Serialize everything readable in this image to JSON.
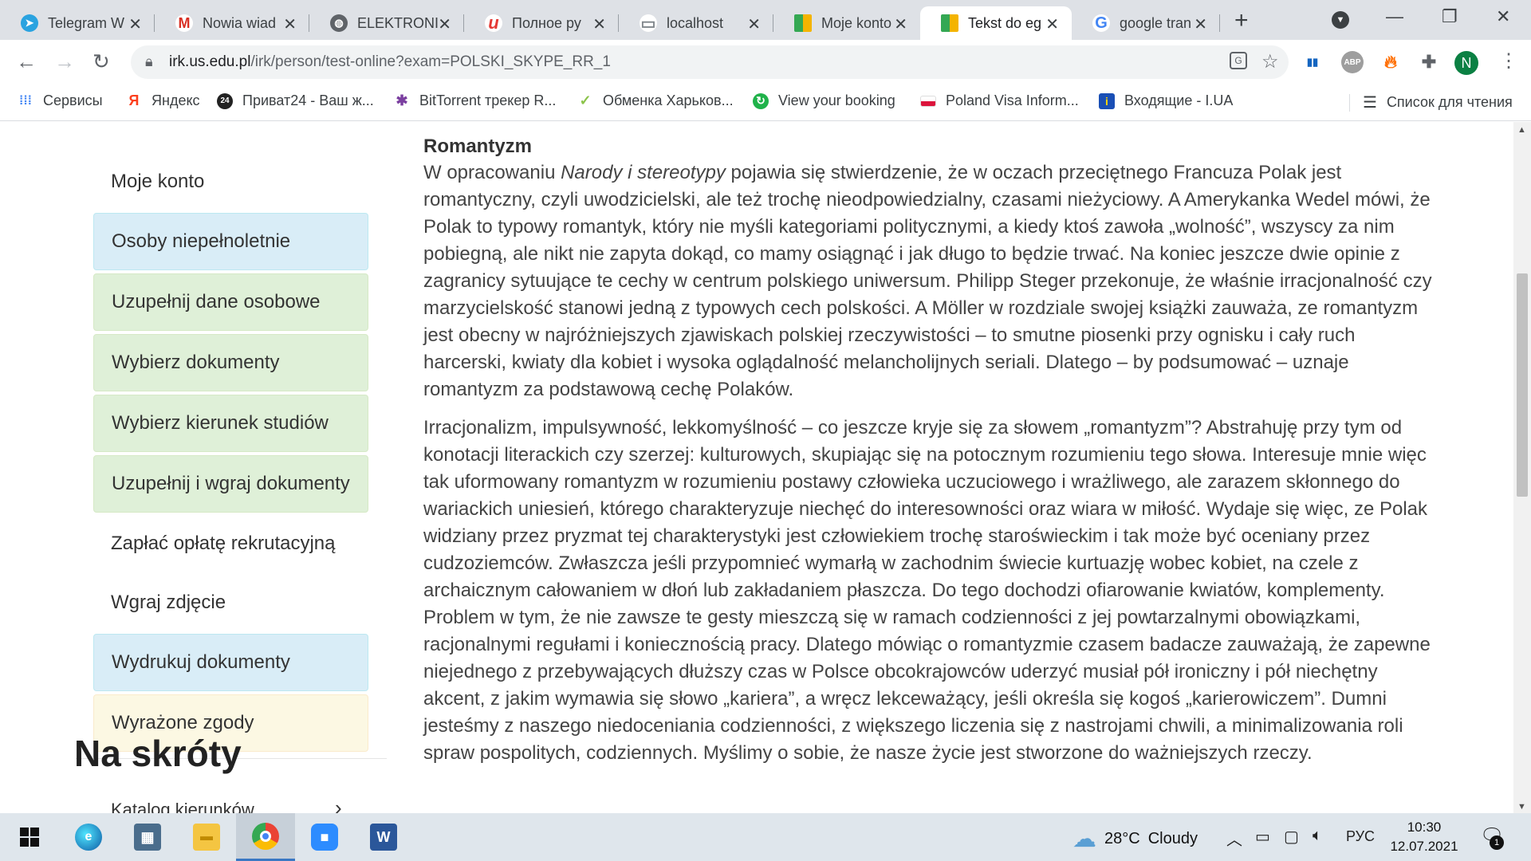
{
  "browser": {
    "tabs": [
      {
        "title": "Telegram W",
        "icon": "telegram-icon",
        "color": "#2aa3e0",
        "glyph": "➤"
      },
      {
        "title": "Nowia wiad",
        "icon": "gmail-icon",
        "color": "#d93025",
        "glyph": "M"
      },
      {
        "title": "ELEKTRONI",
        "icon": "globe-icon",
        "color": "#5f6368",
        "glyph": "◍"
      },
      {
        "title": "Полное ру",
        "icon": "u-icon",
        "color": "#e53935",
        "glyph": "u"
      },
      {
        "title": "localhost",
        "icon": "page-icon",
        "color": "#80868b",
        "glyph": "▭"
      },
      {
        "title": "Moje konto",
        "icon": "grid-logo-icon",
        "color": "#f4b400",
        "glyph": "■"
      },
      {
        "title": "Tekst do eg",
        "icon": "grid-logo-icon",
        "color": "#f4b400",
        "glyph": "■"
      },
      {
        "title": "google tran",
        "icon": "google-icon",
        "color": "#4285f4",
        "glyph": "G"
      }
    ],
    "url_host": "irk.us.edu.pl",
    "url_path": "/irk/person/test-online?exam=POLSKI_SKYPE_RR_1",
    "profile_initial": "N"
  },
  "bookmarks": {
    "items": [
      {
        "label": "Сервисы",
        "icon": "apps-grid-icon",
        "color": "#4285f4",
        "glyph": "⋮⋮"
      },
      {
        "label": "Яндекс",
        "icon": "yandex-icon",
        "color": "#fc3f1d",
        "glyph": "Я"
      },
      {
        "label": "Приват24 - Ваш ж...",
        "icon": "privat24-icon",
        "color": "#222222",
        "glyph": "24"
      },
      {
        "label": "BitTorrent трекер R...",
        "icon": "rutracker-icon",
        "color": "#7b3fa0",
        "glyph": "✱"
      },
      {
        "label": "Обменка Харьков...",
        "icon": "exchange-icon",
        "color": "#8bc34a",
        "glyph": "✓"
      },
      {
        "label": "View your booking",
        "icon": "booking-icon",
        "color": "#20b24a",
        "glyph": "↻"
      },
      {
        "label": "Poland Visa Inform...",
        "icon": "poland-flag-icon",
        "color": "#dc143c",
        "glyph": "▬"
      },
      {
        "label": "Входящие - I.UA",
        "icon": "iua-mail-icon",
        "color": "#1a4fb5",
        "glyph": "i"
      }
    ],
    "reading_list": "Список для чтения"
  },
  "sidebar": {
    "items": [
      {
        "label": "Moje konto",
        "style": "plain"
      },
      {
        "label": "Osoby niepełnoletnie",
        "style": "blue"
      },
      {
        "label": "Uzupełnij dane osobowe",
        "style": "green"
      },
      {
        "label": "Wybierz dokumenty",
        "style": "green"
      },
      {
        "label": "Wybierz kierunek studiów",
        "style": "green"
      },
      {
        "label": "Uzupełnij i wgraj dokumenty",
        "style": "green"
      },
      {
        "label": "Zapłać opłatę rekrutacyjną",
        "style": "plain"
      },
      {
        "label": "Wgraj zdjęcie",
        "style": "plain"
      },
      {
        "label": "Wydrukuj dokumenty",
        "style": "blue"
      },
      {
        "label": "Wyrażone zgody",
        "style": "yellow"
      }
    ],
    "shortcuts_heading": "Na skróty",
    "shortcut_first": "Katalog kierunków"
  },
  "article": {
    "heading": "Romantyzm",
    "p1_before": "W opracowaniu ",
    "p1_italic": "Narody i stereotypy",
    "p1_after": " pojawia się stwierdzenie, że w oczach przeciętnego Francuza Polak jest romantyczny, czyli uwodzicielski, ale też trochę nieodpowiedzialny, czasami nieżyciowy. A Amerykanka Wedel mówi, że Polak to typowy romantyk, który nie myśli kategoriami politycznymi, a kiedy ktoś zawoła „wolność”, wszyscy za nim pobiegną, ale nikt nie zapyta dokąd, co mamy osiągnąć i jak długo to będzie trwać. Na koniec jeszcze dwie opinie z zagranicy sytuujące te cechy w centrum polskiego uniwersum. Philipp Steger przekonuje, że właśnie irracjonalność czy marzycielskość stanowi jedną z typowych cech polskości. A Möller w rozdziale swojej książki zauważa, ze romantyzm jest obecny w najróżniejszych zjawiskach polskiej rzeczywistości – to smutne piosenki przy ognisku i cały ruch harcerski, kwiaty dla kobiet i wysoka oglądalność melancholijnych seriali. Dlatego – by podsumować – uznaje romantyzm za podstawową cechę Polaków.",
    "p2": "Irracjonalizm, impulsywność, lekkomyślność – co jeszcze kryje się za słowem „romantyzm”? Abstrahuję przy tym od konotacji literackich czy szerzej: kulturowych, skupiając się na potocznym rozumieniu tego słowa. Interesuje mnie więc tak uformowany romantyzm w rozumieniu postawy człowieka uczuciowego i wrażliwego, ale zarazem skłonnego do wariackich uniesień, którego charakteryzuje niechęć do interesowności oraz wiara w miłość. Wydaje się więc, ze Polak widziany przez pryzmat tej charakterystyki jest człowiekiem trochę staroświeckim i tak może być oceniany przez cudzoziemców. Zwłaszcza jeśli przypomnieć wymarłą w zachodnim świecie kurtuazję wobec kobiet, na czele z archaicznym całowaniem w dłoń lub zakładaniem płaszcza. Do tego dochodzi ofiarowanie kwiatów, komplementy. Problem w tym, że nie zawsze te gesty mieszczą się w ramach codzienności z jej powtarzalnymi obowiązkami, racjonalnymi regułami i koniecznością pracy. Dlatego mówiąc o romantyzmie czasem badacze zauważają, że zapewne niejednego z przebywających dłuższy czas w Polsce obcokrajowców uderzyć musiał pół ironiczny i pół niechętny akcent, z jakim wymawia się słowo „kariera”, a wręcz lekceważący, jeśli określa się kogoś „karierowiczem”. Dumni jesteśmy z naszego niedoceniania codzienności, z większego liczenia się z nastrojami chwili, a minimalizowania roli spraw pospolitych, codziennych. Myślimy o sobie, że nasze życie jest stworzone do ważniejszych rzeczy."
  },
  "taskbar": {
    "weather_temp": "28°C",
    "weather_desc": "Cloudy",
    "language": "РУС",
    "time": "10:30",
    "date": "12.07.2021",
    "notification_count": "1"
  }
}
